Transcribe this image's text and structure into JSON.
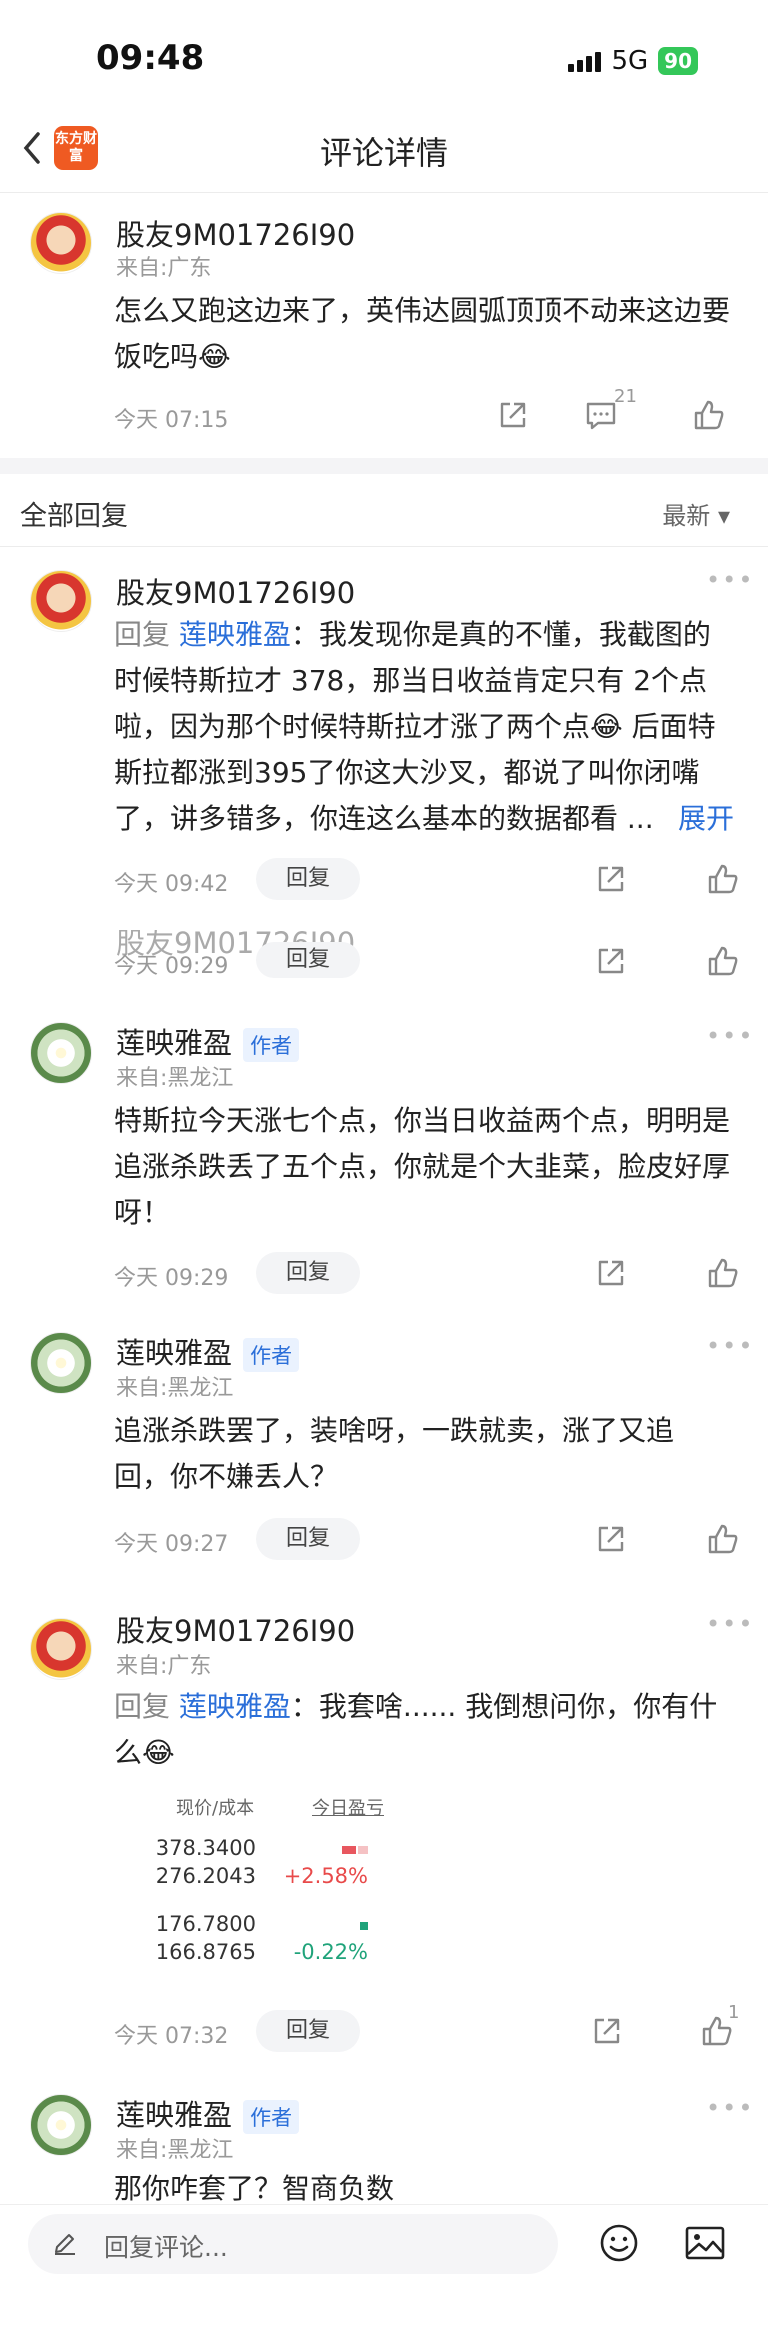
{
  "status_bar": {
    "time": "09:48",
    "network": "5G",
    "battery": "90"
  },
  "nav": {
    "logo_text": "东方财富",
    "title": "评论详情"
  },
  "main_comment": {
    "user": "股友9M01726I90",
    "location": "来自:广东",
    "text": "怎么又跑这边来了，英伟达圆弧顶顶不动来这边要饭吃吗😂",
    "time": "今天 07:15",
    "comment_count": "21"
  },
  "replies_header": {
    "title": "全部回复",
    "sort": "最新 ▾"
  },
  "replies": [
    {
      "user": "股友9M01726I90",
      "reply_prefix": "回复 ",
      "mention": "莲映雅盈",
      "text_lines": [
        "：我发现你是真的不懂，我截图的",
        "时候特斯拉才 378，那当日收益肯定只有 2个点",
        "啦，因为那个时候特斯拉才涨了两个点😂 后面特",
        "斯拉都涨到395了你这大沙叉，都说了叫你闭嘴",
        "了，讲多错多，你连这么基本的数据都看 ..."
      ],
      "expand": "展开",
      "time": "今天 09:42",
      "reply_label": "回复"
    },
    {
      "user": "股友9M01726I90",
      "time": "今天 09:29",
      "reply_label": "回复"
    },
    {
      "user": "莲映雅盈",
      "author_tag": "作者",
      "location": "来自:黑龙江",
      "text_lines": [
        "特斯拉今天涨七个点，你当日收益两个点，明明是",
        "追涨杀跌丢了五个点，你就是个大韭菜，脸皮好厚",
        "呀！"
      ],
      "time": "今天 09:29",
      "reply_label": "回复"
    },
    {
      "user": "莲映雅盈",
      "author_tag": "作者",
      "location": "来自:黑龙江",
      "text_lines": [
        "追涨杀跌罢了，装啥呀，一跌就卖，涨了又追",
        "回，你不嫌丢人？"
      ],
      "time": "今天 09:27",
      "reply_label": "回复"
    },
    {
      "user": "股友9M01726I90",
      "location": "来自:广东",
      "reply_prefix": "回复 ",
      "mention": "莲映雅盈",
      "text_lines": [
        "：我套啥...... 我倒想问你，你有什",
        "么😂"
      ],
      "portfolio": {
        "col1": "现价/成本",
        "col2": "今日盈亏",
        "rows": [
          {
            "price": "378.3400",
            "cost": "276.2043",
            "pct": "+2.58%"
          },
          {
            "price": "176.7800",
            "cost": "166.8765",
            "pct": "-0.22%"
          }
        ]
      },
      "time": "今天 07:32",
      "reply_label": "回复",
      "like_count": "1"
    },
    {
      "user": "莲映雅盈",
      "author_tag": "作者",
      "location": "来自:黑龙江",
      "text_lines": [
        "那你咋套了？智商负数"
      ]
    }
  ],
  "bottom_bar": {
    "placeholder": "回复评论..."
  },
  "colors": {
    "brand": "#ef5a22",
    "link": "#2b6fd9",
    "up": "#e84a4a",
    "down": "#1fa37a"
  }
}
